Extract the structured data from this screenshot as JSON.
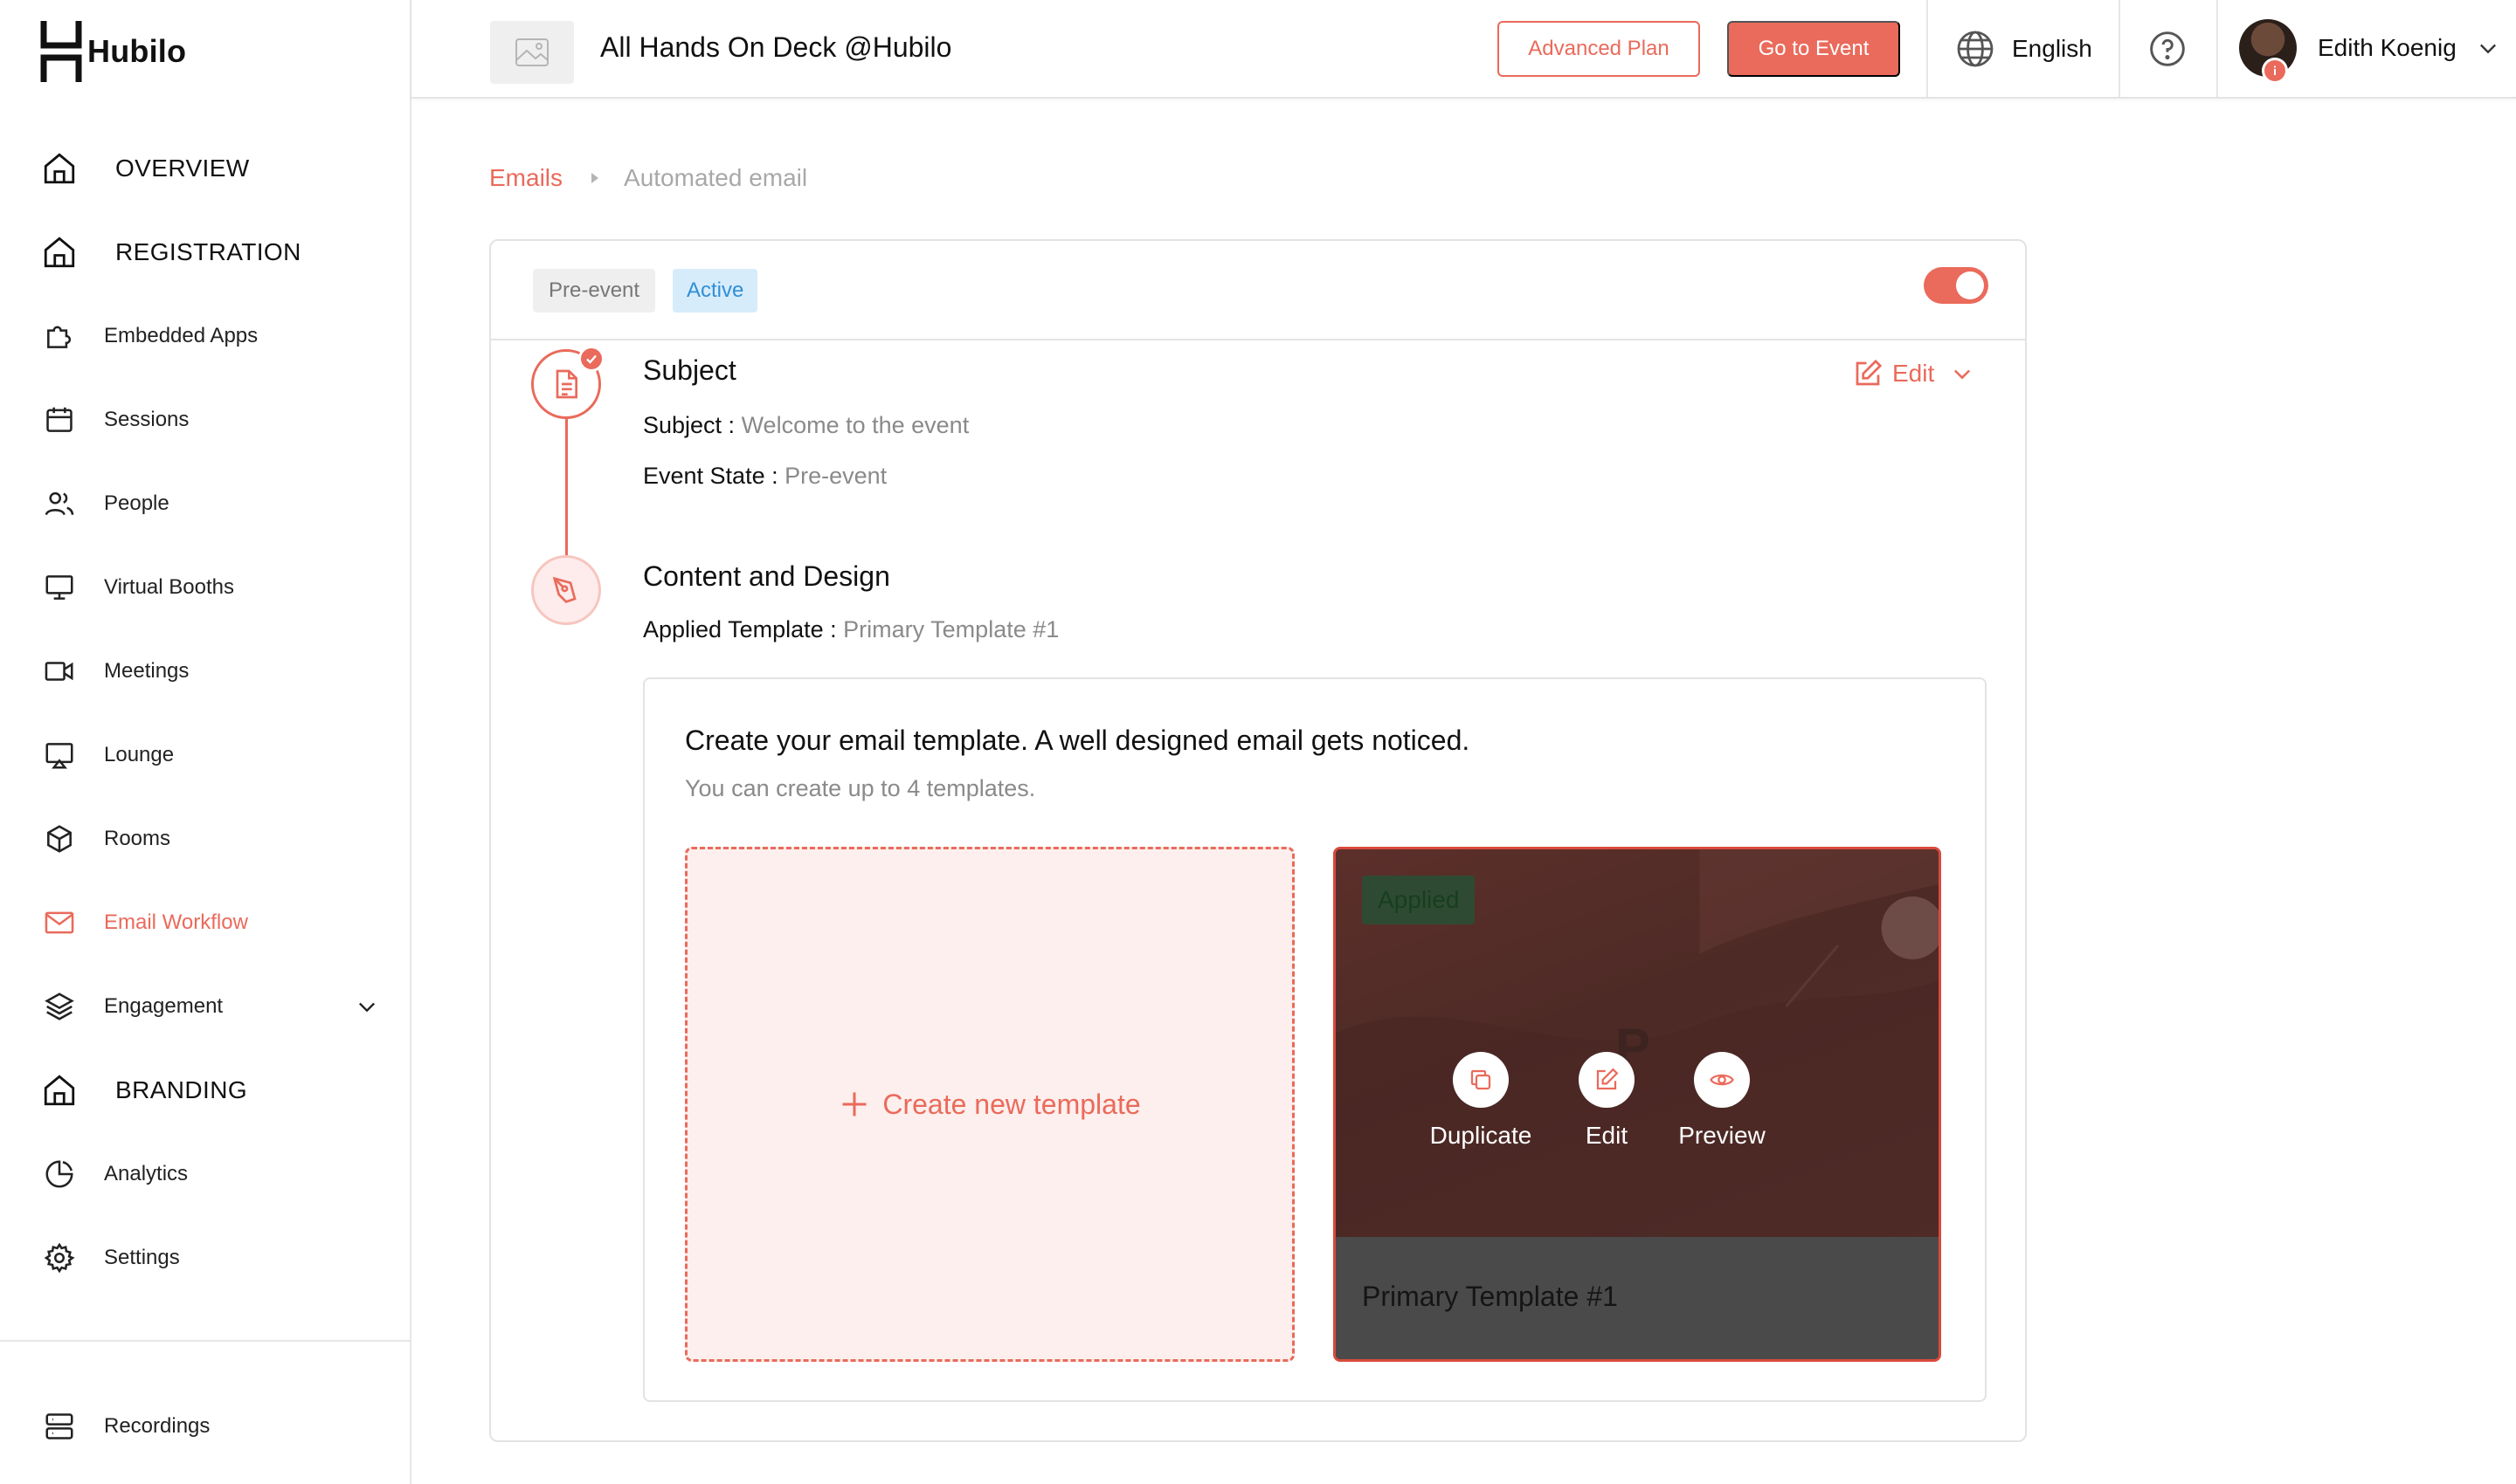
{
  "app": {
    "name": "Hubilo"
  },
  "sidebar": {
    "items": [
      {
        "label": "OVERVIEW"
      },
      {
        "label": "REGISTRATION"
      },
      {
        "label": "Embedded Apps"
      },
      {
        "label": "Sessions"
      },
      {
        "label": "People"
      },
      {
        "label": "Virtual Booths"
      },
      {
        "label": "Meetings"
      },
      {
        "label": "Lounge"
      },
      {
        "label": "Rooms"
      },
      {
        "label": "Email Workflow"
      },
      {
        "label": "Engagement"
      },
      {
        "label": "BRANDING"
      },
      {
        "label": "Analytics"
      },
      {
        "label": "Settings"
      },
      {
        "label": "Recordings"
      }
    ]
  },
  "header": {
    "event_title": "All Hands On Deck @Hubilo",
    "plan_button": "Advanced Plan",
    "go_button": "Go to Event",
    "language": "English",
    "user_name": "Edith Koenig"
  },
  "breadcrumb": {
    "root": "Emails",
    "current": "Automated email"
  },
  "card": {
    "tags": [
      "Pre-event",
      "Active"
    ],
    "toggle_on": true,
    "subject_section": {
      "title": "Subject",
      "edit_label": "Edit",
      "subject_key": "Subject : ",
      "subject_value": "Welcome to the event",
      "state_key": "Event State : ",
      "state_value": "Pre-event"
    },
    "content_section": {
      "title": "Content and Design",
      "template_key": "Applied Template : ",
      "template_value": "Primary Template #1"
    },
    "template_box": {
      "heading": "Create your email template. A well designed email gets noticed.",
      "subheading": "You can create up to 4 templates.",
      "create_label": "Create new template",
      "template": {
        "badge": "Applied",
        "name": "Primary Template #1",
        "actions": [
          "Duplicate",
          "Edit",
          "Preview"
        ]
      }
    }
  },
  "colors": {
    "accent": "#ea6a5b",
    "active_tag": "#2f8fd6",
    "active_tag_bg": "#d7ecfb"
  }
}
